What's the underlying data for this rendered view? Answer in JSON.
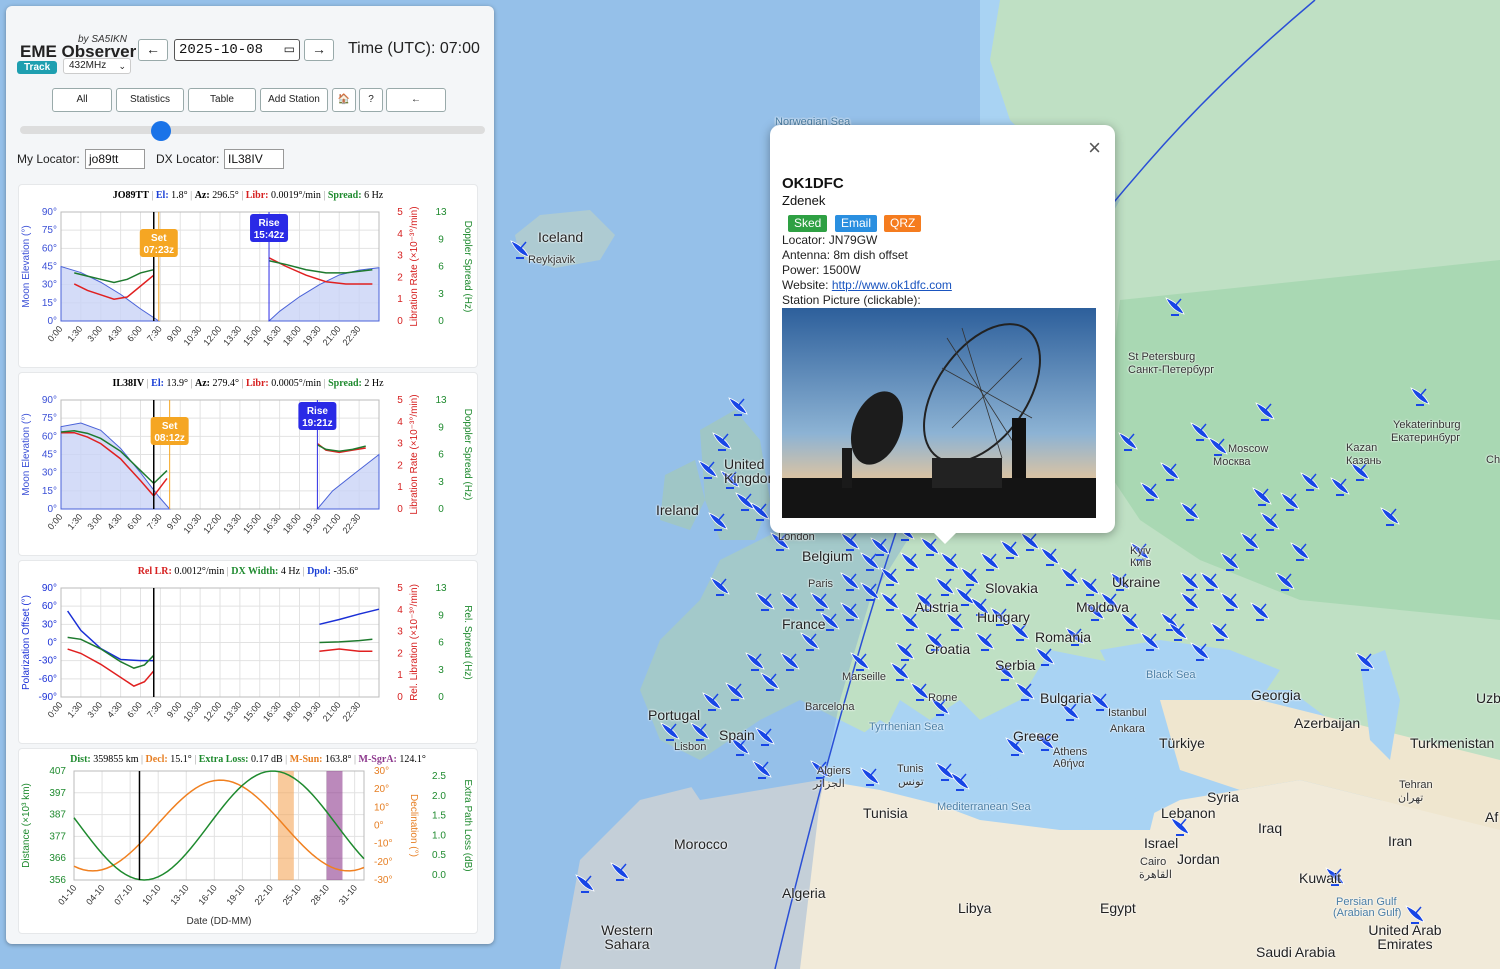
{
  "app": {
    "by": "by SA5IKN",
    "title": "EME Observer",
    "track_label": "Track",
    "band": "432MHz"
  },
  "date": {
    "prev": "←",
    "value": "2025-10-08",
    "next": "→"
  },
  "time": "Time (UTC): 07:00",
  "nav": [
    "All",
    "Statistics",
    "Table",
    "Add Station",
    "🏠",
    "?",
    "←"
  ],
  "my_locator": {
    "label": "My Locator:",
    "value": "jo89tt"
  },
  "dx_locator": {
    "label": "DX Locator:",
    "value": "IL38IV"
  },
  "time_ticks": [
    "0:00",
    "1:30",
    "3:00",
    "4:30",
    "6:00",
    "7:30",
    "9:00",
    "10:30",
    "12:00",
    "13:30",
    "15:00",
    "16:30",
    "18:00",
    "19:30",
    "21:00",
    "22:30"
  ],
  "chart1": {
    "loc": "JO89TT",
    "el_label": "El:",
    "el": "1.8°",
    "az_label": "Az:",
    "az": "296.5°",
    "libr_label": "Libr:",
    "libr": "0.0019°/min",
    "spread_label": "Spread:",
    "spread": "6 Hz",
    "set_label": "Set",
    "set_time": "07:23z",
    "rise_label": "Rise",
    "rise_time": "15:42z",
    "ylabel_left": "Moon Elevation (°)",
    "ylabel_mid": "Libration Rate (×10⁻³°/min)",
    "ylabel_right": "Doppler Spread (Hz)",
    "left_ticks": [
      "90°",
      "75°",
      "60°",
      "45°",
      "30°",
      "15°",
      "0°"
    ],
    "mid_ticks": [
      "5",
      "4",
      "3",
      "2",
      "1",
      "0"
    ],
    "right_ticks": [
      "13",
      "9",
      "6",
      "3",
      "0"
    ]
  },
  "chart2": {
    "loc": "IL38IV",
    "el_label": "El:",
    "el": "13.9°",
    "az_label": "Az:",
    "az": "279.4°",
    "libr_label": "Libr:",
    "libr": "0.0005°/min",
    "spread_label": "Spread:",
    "spread": "2 Hz",
    "set_label": "Set",
    "set_time": "08:12z",
    "rise_label": "Rise",
    "rise_time": "19:21z",
    "ylabel_left": "Moon Elevation (°)",
    "ylabel_mid": "Libration Rate (×10⁻³°/min)",
    "ylabel_right": "Doppler Spread (Hz)",
    "left_ticks": [
      "90°",
      "75°",
      "60°",
      "45°",
      "30°",
      "15°",
      "0°"
    ],
    "mid_ticks": [
      "5",
      "4",
      "3",
      "2",
      "1",
      "0"
    ],
    "right_ticks": [
      "13",
      "9",
      "6",
      "3",
      "0"
    ]
  },
  "chart3": {
    "rel_label": "Rel LR:",
    "rel": "0.0012°/min",
    "dxw_label": "DX Width:",
    "dxw": "4 Hz",
    "dpol_label": "Dpol:",
    "dpol": "-35.6°",
    "ylabel_left": "Polarization Offset (°)",
    "ylabel_mid": "Rel. Libration (×10⁻³°/min)",
    "ylabel_right": "Rel. Spread (Hz)",
    "left_ticks": [
      "90°",
      "60°",
      "30°",
      "0°",
      "-30°",
      "-60°",
      "-90°"
    ],
    "mid_ticks": [
      "5",
      "4",
      "3",
      "2",
      "1",
      "0"
    ],
    "right_ticks": [
      "13",
      "9",
      "6",
      "3",
      "0"
    ]
  },
  "chart4": {
    "dist_label": "Dist:",
    "dist": "359855 km",
    "decl_label": "Decl:",
    "decl": "15.1°",
    "loss_label": "Extra Loss:",
    "loss": "0.17 dB",
    "msun_label": "M-Sun:",
    "msun": "163.8°",
    "msgra_label": "M-SgrA:",
    "msgra": "124.1°",
    "ylabel_left": "Distance (×10³ km)",
    "ylabel_mid": "Declination (°)",
    "ylabel_right": "Extra Path Loss (dB)",
    "xlabel": "Date (DD-MM)",
    "left_ticks": [
      "407",
      "397",
      "387",
      "377",
      "366",
      "356"
    ],
    "mid_ticks": [
      "30°",
      "20°",
      "10°",
      "0°",
      "-10°",
      "-20°",
      "-30°"
    ],
    "right_ticks": [
      "2.5",
      "2.0",
      "1.5",
      "1.0",
      "0.5",
      "0.0"
    ],
    "date_ticks": [
      "01-10",
      "04-10",
      "07-10",
      "10-10",
      "13-10",
      "16-10",
      "19-10",
      "22-10",
      "25-10",
      "28-10",
      "31-10"
    ]
  },
  "popup": {
    "call": "OK1DFC",
    "name": "Zdenek",
    "badges": [
      "Sked",
      "Email",
      "QRZ"
    ],
    "locator": "Locator: JN79GW",
    "antenna": "Antenna: 8m dish offset",
    "power": "Power: 1500W",
    "website_label": "Website: ",
    "website": "http://www.ok1dfc.com",
    "picture": "Station Picture (clickable):",
    "close": "×"
  },
  "map_labels": [
    "Norwegian Sea",
    "Iceland",
    "Reykjavik",
    "St Petersburg",
    "Санкт-Петербург",
    "Yekaterinburg",
    "Екатеринбург",
    "Kazan",
    "Казань",
    "Moscow",
    "Москва",
    "Ireland",
    "United Kingdom",
    "London",
    "Belgium",
    "Paris",
    "France",
    "Kyiv",
    "Київ",
    "Ukraine",
    "Slovakia",
    "Austria",
    "Hungary",
    "Moldova",
    "Romania",
    "Croatia",
    "Serbia",
    "Marseille",
    "Rome",
    "Bulgaria",
    "Black Sea",
    "Georgia",
    "Azerbaijan",
    "Uzb",
    "Portugal",
    "Lisbon",
    "Spain",
    "Barcelona",
    "Tyrrhenian Sea",
    "Istanbul",
    "Ankara",
    "Türkiye",
    "Turkmenistan",
    "Greece",
    "Athens",
    "Αθήνα",
    "Algiers",
    "الجزائر",
    "Tunis",
    "تونس",
    "Tunisia",
    "Mediterranean Sea",
    "Syria",
    "Lebanon",
    "Iraq",
    "Iran",
    "Tehran",
    "تهران",
    "Israel",
    "Jordan",
    "Cairo",
    "القاهرة",
    "Kuwait",
    "Persian Gulf",
    "(Arabian Gulf)",
    "United Arab Emirates",
    "Morocco",
    "Algeria",
    "Libya",
    "Egypt",
    "Western Sahara",
    "Saudi Arabia",
    "Af",
    "Ch"
  ],
  "colors": {
    "accent": "#1a73e8",
    "set": "#f5a623",
    "rise": "#2a2ae6",
    "sked": "#2ea043",
    "email": "#2a8fe0",
    "qrz": "#f57c1f",
    "dish": "#1846e6"
  }
}
